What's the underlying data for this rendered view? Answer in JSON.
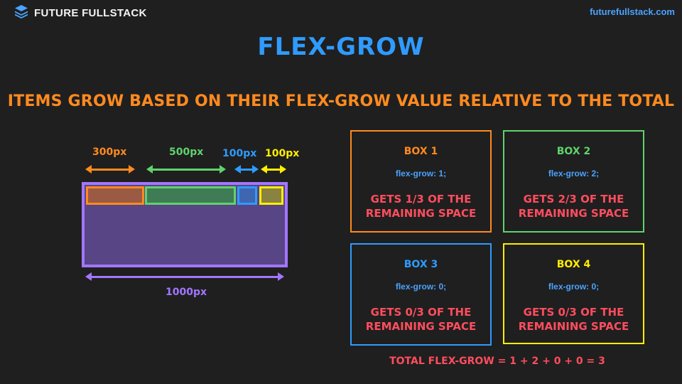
{
  "header": {
    "brand": "FUTURE FULLSTACK",
    "logo_icon": "layers-stack-icon",
    "site": "futurefullstack.com"
  },
  "title": "FLEX-GROW",
  "subtitle": "ITEMS GROW BASED ON THEIR FLEX-GROW VALUE RELATIVE TO THE TOTAL",
  "diagram": {
    "items": [
      {
        "width_label": "300px",
        "color": "#ff8a1f"
      },
      {
        "width_label": "500px",
        "color": "#5fd36b"
      },
      {
        "width_label": "100px",
        "color": "#2f9bff"
      },
      {
        "width_label": "100px",
        "color": "#ffee00"
      }
    ],
    "container_label": "1000px",
    "container_color": "#a276ff"
  },
  "boxes": [
    {
      "title": "BOX 1",
      "prop": "flex-grow: 1;",
      "desc_line1": "GETS 1/3 OF THE",
      "desc_line2": "REMAINING SPACE",
      "color": "#ff8a1f"
    },
    {
      "title": "BOX  2",
      "prop": "flex-grow: 2;",
      "desc_line1": "GETS 2/3  OF THE",
      "desc_line2": "REMAINING SPACE",
      "color": "#5fd36b"
    },
    {
      "title": "BOX 3",
      "prop": "flex-grow: 0;",
      "desc_line1": "GETS 0/3 OF THE",
      "desc_line2": "REMAINING SPACE",
      "color": "#2f9bff"
    },
    {
      "title": "BOX  4",
      "prop": "flex-grow: 0;",
      "desc_line1": "GETS 0/3 OF THE",
      "desc_line2": "REMAINING SPACE",
      "color": "#ffee00"
    }
  ],
  "total": "TOTAL FLEX-GROW = 1 + 2 + 0 + 0 = 3"
}
